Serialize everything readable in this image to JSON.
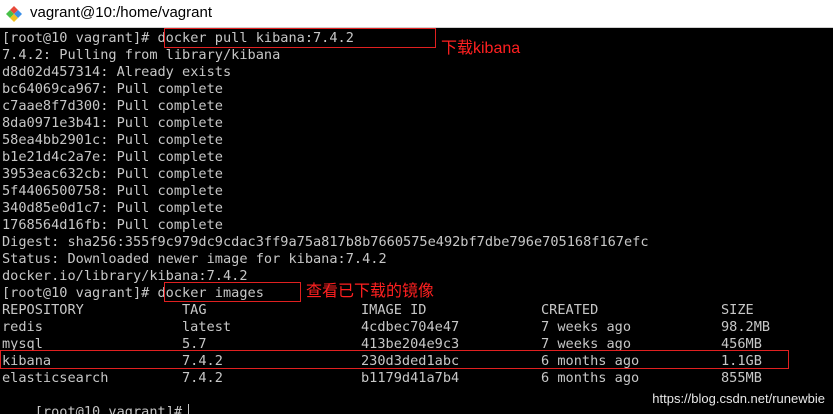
{
  "window": {
    "title": "vagrant@10:/home/vagrant",
    "icon": "putty-icon"
  },
  "terminal": {
    "lines": [
      "[root@10 vagrant]# docker pull kibana:7.4.2",
      "7.4.2: Pulling from library/kibana",
      "d8d02d457314: Already exists",
      "bc64069ca967: Pull complete",
      "c7aae8f7d300: Pull complete",
      "8da0971e3b41: Pull complete",
      "58ea4bb2901c: Pull complete",
      "b1e21d4c2a7e: Pull complete",
      "3953eac632cb: Pull complete",
      "5f4406500758: Pull complete",
      "340d85e0d1c7: Pull complete",
      "1768564d16fb: Pull complete",
      "Digest: sha256:355f9c979dc9cdac3ff9a75a817b8b7660575e492bf7dbe796e705168f167efc",
      "Status: Downloaded newer image for kibana:7.4.2",
      "docker.io/library/kibana:7.4.2",
      "[root@10 vagrant]# docker images"
    ],
    "images_table": {
      "headers": [
        "REPOSITORY",
        "TAG",
        "IMAGE ID",
        "CREATED",
        "SIZE"
      ],
      "rows": [
        [
          "redis",
          "latest",
          "4cdbec704e47",
          "7 weeks ago",
          "98.2MB"
        ],
        [
          "mysql",
          "5.7",
          "413be204e9c3",
          "7 weeks ago",
          "456MB"
        ],
        [
          "kibana",
          "7.4.2",
          "230d3ded1abc",
          "6 months ago",
          "1.1GB"
        ],
        [
          "elasticsearch",
          "7.4.2",
          "b1179d41a7b4",
          "6 months ago",
          "855MB"
        ]
      ]
    },
    "prompt": "[root@10 vagrant]#"
  },
  "annotations": {
    "pull_label": "下载kibana",
    "images_label": "查看已下载的镜像"
  },
  "watermark": "https://blog.csdn.net/runewbie",
  "colors": {
    "terminal_bg": "#000000",
    "terminal_text": "#c7c7c7",
    "annotation_red": "#ff2020"
  }
}
